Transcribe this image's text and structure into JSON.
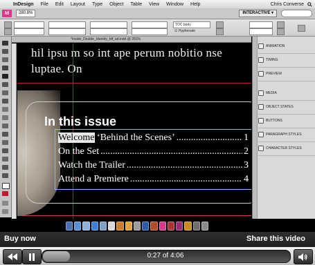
{
  "menubar": {
    "apple_symbol": "",
    "items": [
      "InDesign",
      "File",
      "Edit",
      "Layout",
      "Type",
      "Object",
      "Table",
      "View",
      "Window",
      "Help"
    ],
    "user": "Chris Converse"
  },
  "appbar": {
    "logo": "Id",
    "zoom": "280.8%",
    "workspace": "INTERACTIVE ▾"
  },
  "controlbar": {
    "style_field": "TOC body",
    "hyphenate_label": "Hyphenate"
  },
  "document": {
    "tab_title": "*Inside_Double_Identity_tdf_ad.indd @ 281%",
    "header_text_line1": "hil ipsu m so      int ape perum nobitio nse",
    "header_text_line2": "luptae.  On",
    "heading": "In this issue",
    "selected_word": "Welcome",
    "toc": [
      {
        "title_rest": " ‘Behind the Scenes’",
        "page": "1"
      },
      {
        "title": "On the Set",
        "page": "2"
      },
      {
        "title": "Watch the Trailer",
        "page": "3"
      },
      {
        "title": "Attend a Premiere",
        "page": "4"
      }
    ],
    "dots": "........................................................................"
  },
  "panels": [
    {
      "label": "Animation",
      "icon": "animation-icon"
    },
    {
      "label": "Timing",
      "icon": "timing-icon"
    },
    {
      "label": "Preview",
      "icon": "preview-icon"
    },
    {
      "label": "Media",
      "icon": "media-icon"
    },
    {
      "label": "Object States",
      "icon": "object-states-icon"
    },
    {
      "label": "Buttons",
      "icon": "buttons-icon"
    },
    {
      "label": "Paragraph Styles",
      "icon": "paragraph-styles-icon"
    },
    {
      "label": "Character Styles",
      "icon": "character-styles-icon"
    }
  ],
  "video": {
    "buy_now": "Buy now",
    "share": "Share this video",
    "time": "0:27 of 4:06",
    "progress_fraction": 0.11
  },
  "colors": {
    "accent_magenta": "#d6398c",
    "guide_red": "#c3162f"
  }
}
